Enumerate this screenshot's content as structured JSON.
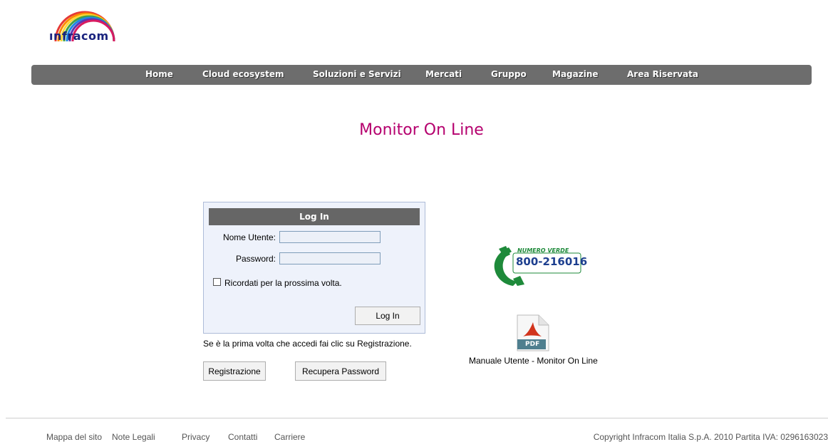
{
  "logo": {
    "text": "ınfracom"
  },
  "nav": {
    "items": [
      {
        "label": "Home"
      },
      {
        "label": "Cloud ecosystem"
      },
      {
        "label": "Soluzioni e Servizi"
      },
      {
        "label": "Mercati"
      },
      {
        "label": "Gruppo"
      },
      {
        "label": "Magazine"
      },
      {
        "label": "Area Riservata"
      }
    ]
  },
  "page": {
    "title": "Monitor On Line"
  },
  "login": {
    "header": "Log In",
    "username_label": "Nome Utente:",
    "username_value": "",
    "password_label": "Password:",
    "password_value": "",
    "remember_label": "Ricordati per la prossima volta.",
    "remember_checked": false,
    "submit_label": "Log In"
  },
  "registration": {
    "hint": "Se è la prima volta che accedi fai clic su Registrazione.",
    "register_label": "Registrazione",
    "recover_label": "Recupera Password"
  },
  "contact": {
    "phone_badge": "NUMERO VERDE",
    "phone_number": "800-216016"
  },
  "manual": {
    "icon_text": "PDF",
    "caption": "Manuale Utente - Monitor On Line"
  },
  "footer": {
    "links": [
      {
        "label": "Mappa del sito"
      },
      {
        "label": "Note Legali"
      },
      {
        "label": "Privacy"
      },
      {
        "label": "Contatti"
      },
      {
        "label": "Carriere"
      }
    ],
    "copyright": "Copyright Infracom Italia S.p.A. 2010 Partita IVA: 0296163023"
  },
  "colors": {
    "title": "#b5006e",
    "navbar": "#6d6d6d",
    "login_bg": "#eef2fb",
    "phone_green": "#1e8a3a",
    "phone_blue": "#1d3f8f",
    "pdf_red": "#d2341c"
  }
}
